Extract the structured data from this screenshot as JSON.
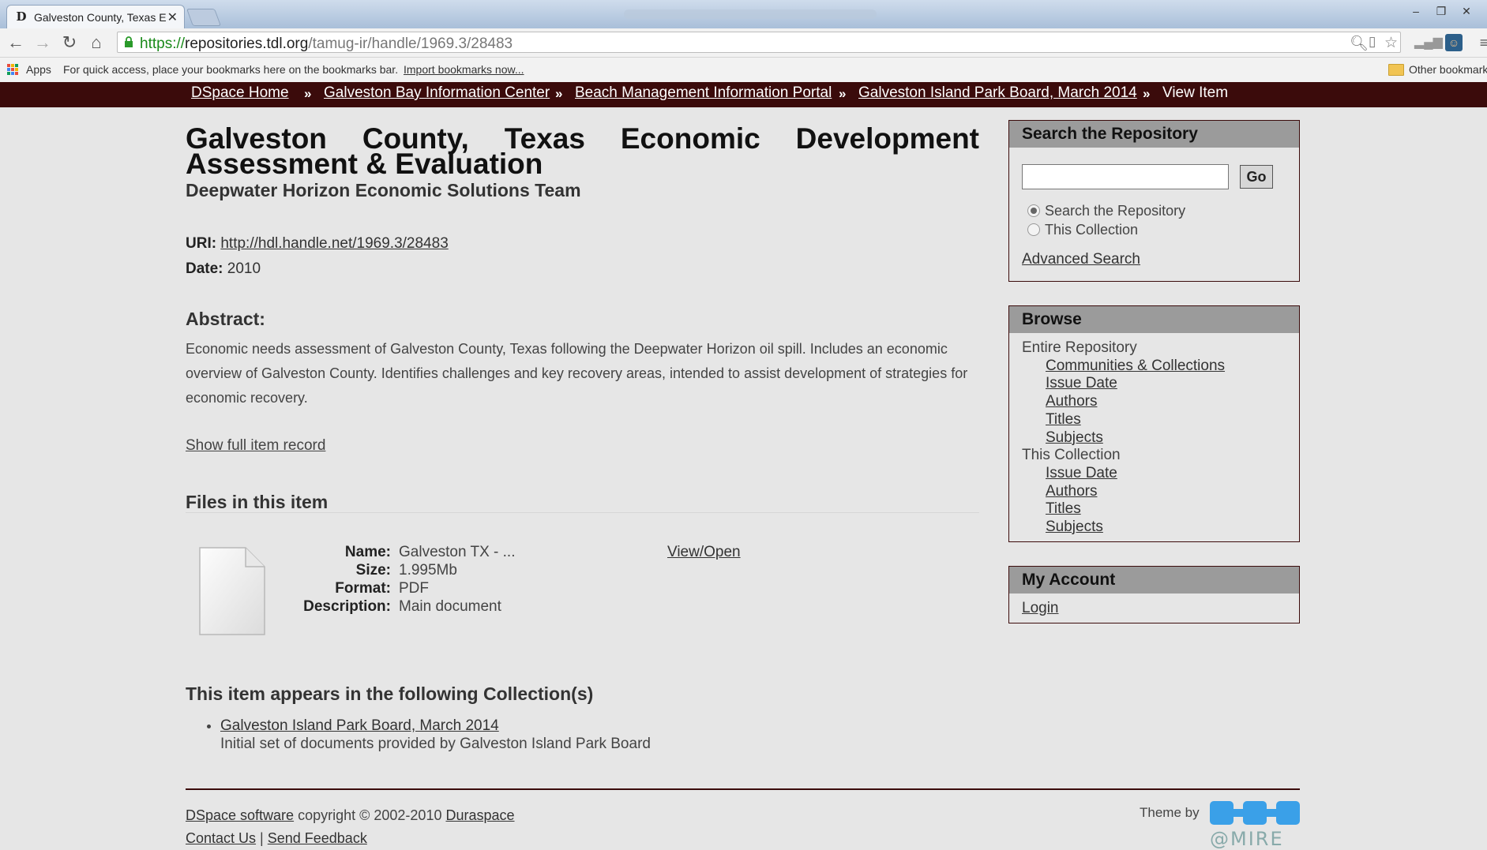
{
  "browser": {
    "tab_title": "Galveston County, Texas E",
    "tab_favicon": "D",
    "url_scheme": "https://",
    "url_host": "repositories.tdl.org",
    "url_path": "/tamug-ir/handle/1969.3/28483",
    "bookmarks": {
      "apps_label": "Apps",
      "hint": "For quick access, place your bookmarks here on the bookmarks bar.",
      "import_link": "Import bookmarks now...",
      "other_label": "Other bookmarks"
    },
    "icons": [
      "back-arrow-icon",
      "forward-arrow-icon",
      "reload-icon",
      "home-icon",
      "lock-icon",
      "zoom-icon",
      "page-icon",
      "star-icon",
      "signal-icon",
      "avatar-icon",
      "menu-icon",
      "folder-icon"
    ]
  },
  "breadcrumb": [
    {
      "label": "DSpace Home"
    },
    {
      "label": "Galveston Bay Information Center"
    },
    {
      "label": "Beach Management Information Portal"
    },
    {
      "label": "Galveston Island Park Board, March 2014"
    },
    {
      "label": "View Item"
    }
  ],
  "item": {
    "title": "Galveston County, Texas Economic Development Assessment & Evaluation",
    "author": "Deepwater Horizon Economic Solutions Team",
    "uri_label": "URI:",
    "uri": "http://hdl.handle.net/1969.3/28483",
    "date_label": "Date:",
    "date": "2010",
    "abstract_heading": "Abstract:",
    "abstract": "Economic needs assessment of Galveston County, Texas following the Deepwater Horizon oil spill. Includes an economic overview of Galveston County. Identifies challenges and key recovery areas, intended to assist development of strategies for economic recovery.",
    "show_full": "Show full item record"
  },
  "files": {
    "heading": "Files in this item",
    "name_label": "Name:",
    "name": "Galveston TX - ...",
    "size_label": "Size:",
    "size": "1.995Mb",
    "format_label": "Format:",
    "format": "PDF",
    "description_label": "Description:",
    "description": "Main document",
    "view_open": "View/Open"
  },
  "collections": {
    "heading": "This item appears in the following Collection(s)",
    "items": [
      {
        "name": "Galveston Island Park Board, March 2014",
        "description": "Initial set of documents provided by Galveston Island Park Board"
      }
    ]
  },
  "sidebar": {
    "search": {
      "heading": "Search the Repository",
      "go_label": "Go",
      "query": "",
      "scope_repo": "Search the Repository",
      "scope_collection": "This Collection",
      "selected_scope": "Search the Repository",
      "advanced": "Advanced Search"
    },
    "browse": {
      "heading": "Browse",
      "entire_label": "Entire Repository",
      "entire_links": [
        "Communities & Collections",
        "Issue Date",
        "Authors",
        "Titles",
        "Subjects"
      ],
      "collection_label": "This Collection",
      "collection_links": [
        "Issue Date",
        "Authors",
        "Titles",
        "Subjects"
      ]
    },
    "account": {
      "heading": "My Account",
      "login": "Login"
    }
  },
  "footer": {
    "dspace_link": "DSpace software",
    "copyright": " copyright © 2002-2010 ",
    "duraspace_link": "Duraspace",
    "contact_link": "Contact Us",
    "separator": " | ",
    "feedback_link": "Send Feedback",
    "theme_by": "Theme by",
    "theme_logo_text": "@MIRE"
  },
  "colors": {
    "trail_bg": "#3b0b0b",
    "panel_header": "#9b9b9b",
    "page_bg": "#e6e6e6"
  }
}
